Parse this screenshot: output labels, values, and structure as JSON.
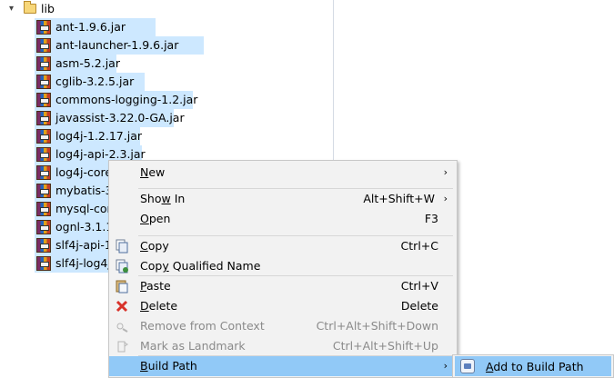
{
  "tree": {
    "root_label": "lib",
    "jars": [
      "ant-1.9.6.jar",
      "ant-launcher-1.9.6.jar",
      "asm-5.2.jar",
      "cglib-3.2.5.jar",
      "commons-logging-1.2.jar",
      "javassist-3.22.0-GA.jar",
      "log4j-1.2.17.jar",
      "log4j-api-2.3.jar",
      "log4j-core",
      "mybatis-3",
      "mysql-cor",
      "ognl-3.1.1",
      "slf4j-api-1",
      "slf4j-log4j"
    ]
  },
  "context_menu": {
    "items": [
      {
        "label": "New",
        "mnemonic": "N",
        "shortcut": "",
        "submenu": true,
        "disabled": false,
        "icon": "none"
      },
      {
        "label": "Show In",
        "mnemonic": "w",
        "shortcut": "Alt+Shift+W",
        "submenu": true,
        "disabled": false,
        "icon": "none"
      },
      {
        "label": "Open",
        "mnemonic": "O",
        "shortcut": "F3",
        "submenu": false,
        "disabled": false,
        "icon": "none"
      },
      {
        "label": "Copy",
        "mnemonic": "C",
        "shortcut": "Ctrl+C",
        "submenu": false,
        "disabled": false,
        "icon": "copy-icon"
      },
      {
        "label": "Copy Qualified Name",
        "mnemonic": "y",
        "shortcut": "",
        "submenu": false,
        "disabled": false,
        "icon": "copy-qualified-name-icon"
      },
      {
        "label": "Paste",
        "mnemonic": "P",
        "shortcut": "Ctrl+V",
        "submenu": false,
        "disabled": false,
        "icon": "paste-icon"
      },
      {
        "label": "Delete",
        "mnemonic": "D",
        "shortcut": "Delete",
        "submenu": false,
        "disabled": false,
        "icon": "delete-icon"
      },
      {
        "label": "Remove from Context",
        "mnemonic": "",
        "shortcut": "Ctrl+Alt+Shift+Down",
        "submenu": false,
        "disabled": true,
        "icon": "remove-from-context-icon"
      },
      {
        "label": "Mark as Landmark",
        "mnemonic": "",
        "shortcut": "Ctrl+Alt+Shift+Up",
        "submenu": false,
        "disabled": true,
        "icon": "landmark-icon"
      },
      {
        "label": "Build Path",
        "mnemonic": "B",
        "shortcut": "",
        "submenu": true,
        "disabled": false,
        "icon": "none",
        "highlighted": true
      }
    ]
  },
  "submenu": {
    "label": "Add to Build Path",
    "mnemonic": "A",
    "icon": "add-to-build-path-icon"
  },
  "colors": {
    "selection": "#cde8ff",
    "menu_highlight": "#91c9f7",
    "menu_background": "#f2f2f2",
    "disabled_text": "#8a8a8a"
  }
}
